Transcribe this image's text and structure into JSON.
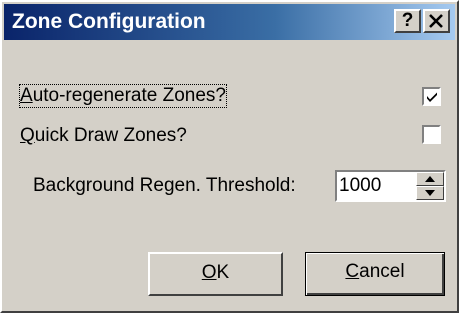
{
  "window": {
    "title": "Zone Configuration",
    "help_button": "?",
    "close_button": "✕"
  },
  "options": {
    "auto_regenerate": {
      "mnemonic": "A",
      "label_rest": "uto-regenerate Zones?",
      "checked": true
    },
    "quick_draw": {
      "mnemonic": "Q",
      "label_rest": "uick Draw Zones?",
      "checked": false
    }
  },
  "threshold": {
    "label": "Background Regen. Threshold:",
    "value": "1000"
  },
  "buttons": {
    "ok": {
      "mnemonic": "O",
      "label_rest": "K"
    },
    "cancel": {
      "mnemonic": "C",
      "label_rest": "ancel"
    }
  },
  "colors": {
    "face": "#d4d0c8",
    "title_start": "#0a246a",
    "title_end": "#a6caf0"
  }
}
